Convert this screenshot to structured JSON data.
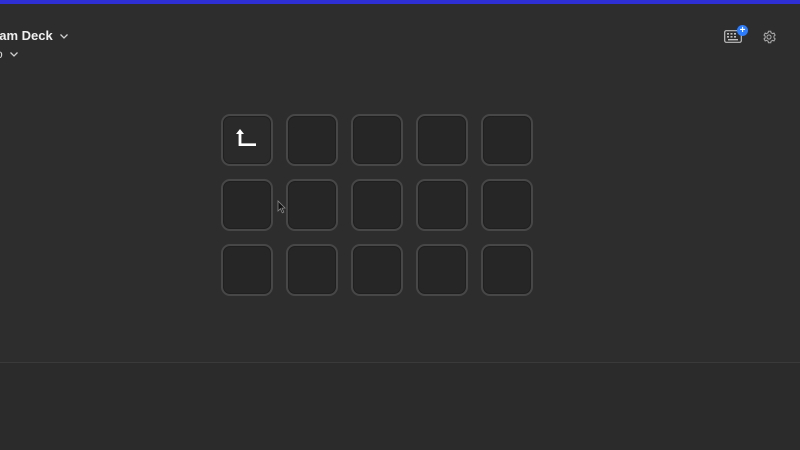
{
  "header": {
    "device_name": "eam Deck",
    "profile_name": "o",
    "store_icon": "keyboard-plus-icon",
    "settings_icon": "gear-icon",
    "badge": "+"
  },
  "grid": {
    "rows": 3,
    "columns": 5,
    "keys": [
      {
        "id": "key-1-1",
        "icon": "back-arrow-icon"
      },
      {
        "id": "key-1-2",
        "icon": ""
      },
      {
        "id": "key-1-3",
        "icon": ""
      },
      {
        "id": "key-1-4",
        "icon": ""
      },
      {
        "id": "key-1-5",
        "icon": ""
      },
      {
        "id": "key-2-1",
        "icon": ""
      },
      {
        "id": "key-2-2",
        "icon": ""
      },
      {
        "id": "key-2-3",
        "icon": ""
      },
      {
        "id": "key-2-4",
        "icon": ""
      },
      {
        "id": "key-2-5",
        "icon": ""
      },
      {
        "id": "key-3-1",
        "icon": ""
      },
      {
        "id": "key-3-2",
        "icon": ""
      },
      {
        "id": "key-3-3",
        "icon": ""
      },
      {
        "id": "key-3-4",
        "icon": ""
      },
      {
        "id": "key-3-5",
        "icon": ""
      }
    ]
  },
  "colors": {
    "accent_bar": "#2f2fd6",
    "background": "#2d2d2d",
    "key_fill": "#262626",
    "key_border": "#474747",
    "badge": "#2b7cff"
  }
}
